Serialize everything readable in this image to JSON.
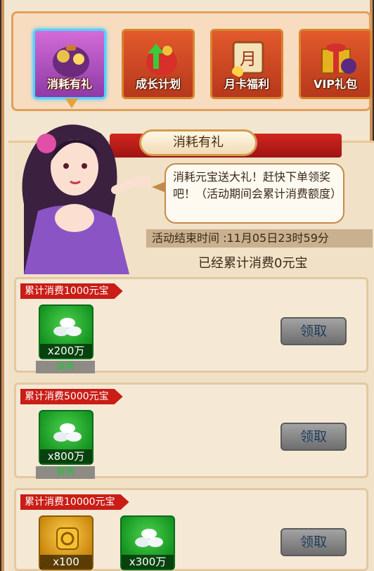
{
  "tabs": [
    {
      "label": "消耗有礼",
      "active": true,
      "icon": "bag-icon"
    },
    {
      "label": "成长计划",
      "active": false,
      "icon": "growth-icon"
    },
    {
      "label": "月卡福利",
      "active": false,
      "icon": "month-card-icon"
    },
    {
      "label": "VIP礼包",
      "active": false,
      "icon": "vip-gift-icon"
    }
  ],
  "header": {
    "title": "消耗有礼"
  },
  "speech": {
    "text": "消耗元宝送大礼！赶快下单领奖吧！（活动期间会累计消费额度）"
  },
  "status": {
    "end_time": "活动结束时间 :11月05日23时59分",
    "spent": "已经累计消费0元宝"
  },
  "rewards": [
    {
      "tag": "累计消费1000元宝",
      "items": [
        {
          "qty": "x200万",
          "name": "银两",
          "type": "silver"
        }
      ],
      "button": "领取"
    },
    {
      "tag": "累计消费5000元宝",
      "items": [
        {
          "qty": "x800万",
          "name": "银两",
          "type": "silver"
        }
      ],
      "button": "领取"
    },
    {
      "tag": "累计消费10000元宝",
      "items": [
        {
          "qty": "x100",
          "type": "gold"
        },
        {
          "qty": "x300万",
          "type": "silver"
        }
      ],
      "button": "领取"
    }
  ],
  "colors": {
    "accent": "#c91d16",
    "active_tab": "#4fd3ff",
    "item_green": "#13911e",
    "item_gold": "#c7850b"
  }
}
